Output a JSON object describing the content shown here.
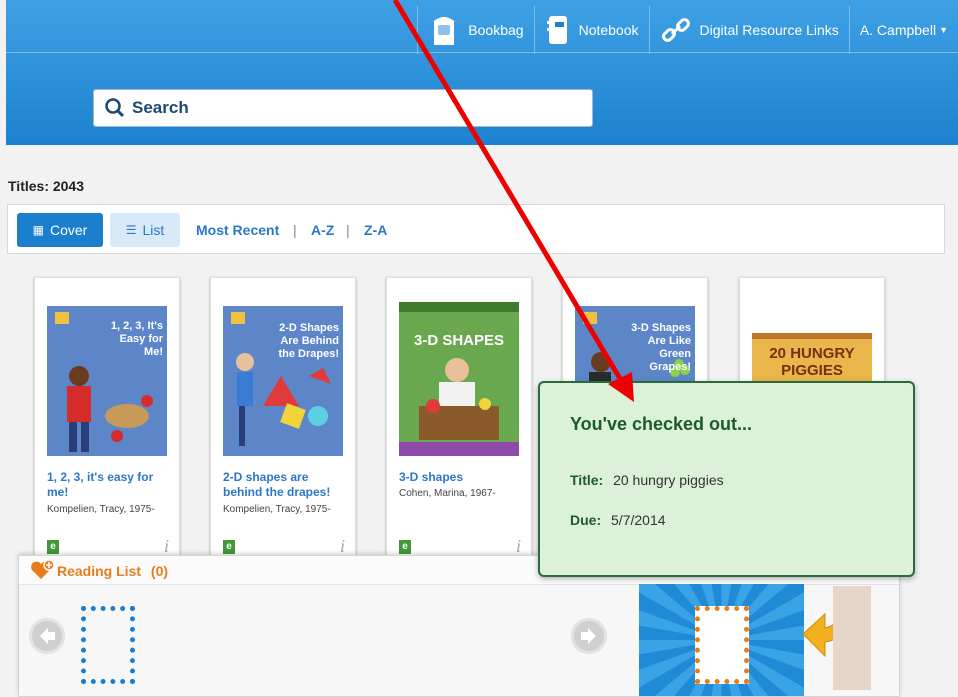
{
  "nav": {
    "bookbag": "Bookbag",
    "notebook": "Notebook",
    "digital_links": "Digital Resource Links",
    "user": "A. Campbell"
  },
  "search": {
    "label": "Search"
  },
  "titles_count": "Titles: 2043",
  "toolbar": {
    "cover": "Cover",
    "list": "List",
    "most_recent": "Most Recent",
    "az": "A-Z",
    "za": "Z-A",
    "sep": "|"
  },
  "books": [
    {
      "title": "1, 2, 3, it's easy for me!",
      "author": "Kompelien, Tracy, 1975-",
      "cover_text": "1, 2, 3, It's Easy for Me!",
      "cover_color": "#5d86c9"
    },
    {
      "title": "2-D shapes are behind the drapes!",
      "author": "Kompelien, Tracy, 1975-",
      "cover_text": "2-D Shapes Are Behind the Drapes!",
      "cover_color": "#5d86c9"
    },
    {
      "title": "3-D shapes",
      "author": "Cohen, Marina, 1967-",
      "cover_text": "3-D SHAPES",
      "cover_color": "#6aa84f"
    },
    {
      "title": "",
      "author": "",
      "cover_text": "3-D Shapes Are Like Green Grapes!",
      "cover_color": "#5d86c9"
    },
    {
      "title": "",
      "author": "",
      "cover_text": "20 HUNGRY PIGGIES",
      "cover_color": "#e8b64a"
    }
  ],
  "badge": "e",
  "info": "i",
  "reading_list": {
    "label": "Reading List",
    "count": "(0)"
  },
  "popup": {
    "heading": "You've checked out...",
    "title_label": "Title:",
    "title_value": "20 hungry piggies",
    "due_label": "Due:",
    "due_value": "5/7/2014"
  },
  "colors": {
    "accent": "#1a7fcf",
    "popup_bg": "#dbf1d8",
    "popup_border": "#2d6a3b",
    "reading_orange": "#e97c1a",
    "annotation_arrow": "#ee0000"
  }
}
